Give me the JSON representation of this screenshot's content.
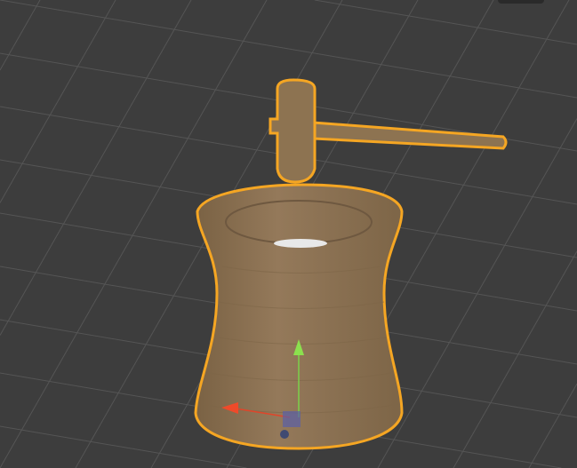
{
  "viewport": {
    "background": "#3d3d3d",
    "grid_color": "#555555",
    "selection_outline": "#f5a623",
    "wood_color": "#8d7351",
    "icons": [
      "gizmo-z-arrow-icon",
      "gizmo-x-arrow-icon",
      "gizmo-origin-icon"
    ]
  }
}
